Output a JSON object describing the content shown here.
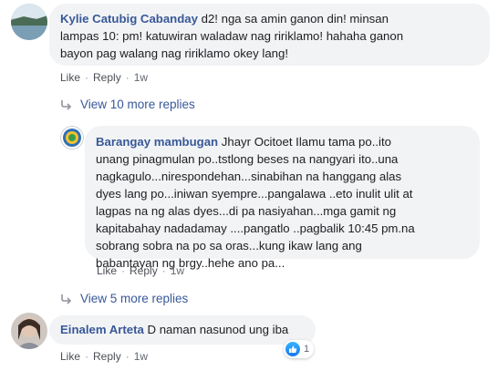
{
  "comments": [
    {
      "author": "Kylie Catubig Cabanday",
      "text_lines": [
        "d2! nga sa amin ganon din! minsan",
        "lampas 10: pm! katuwiran waladaw nag ririklamo! hahaha ganon",
        "bayon pag walang nag ririklamo okey lang!"
      ],
      "like_label": "Like",
      "reply_label": "Reply",
      "time": "1w"
    }
  ],
  "view_more_1": "View 10 more replies",
  "reply": {
    "author": "Barangay mambugan",
    "text_lines": [
      "Jhayr Ocitoet Ilamu tama po..ito",
      "unang pinagmulan po..tstlong beses na nangyari ito..una",
      "nagkagulo...nirespondehan...sinabihan na hanggang alas",
      "dyes lang po...iniwan syempre...pangalawa ..eto inulit ulit at",
      "lagpas na ng alas dyes...di pa nasiyahan...mga gamit ng",
      "kapitabahay nadadamay ....pangatlo ..pagbalik 10:45 pm.na",
      "sobrang sobra na po sa oras...kung ikaw lang ang",
      "babantayan ng brgy..hehe ano pa..."
    ],
    "like_label": "Like",
    "reply_label": "Reply",
    "time": "1w"
  },
  "view_more_2": "View 5 more replies",
  "last_comment": {
    "author": "Einalem Arteta",
    "text": "D naman nasunod ung iba",
    "like_label": "Like",
    "reply_label": "Reply",
    "time": "1w",
    "reaction_count": "1",
    "reaction_icon": "like-icon"
  },
  "colors": {
    "name": "#385898",
    "bubble": "#f2f3f5",
    "meta": "#606770",
    "like_blue": "#1877f2"
  }
}
